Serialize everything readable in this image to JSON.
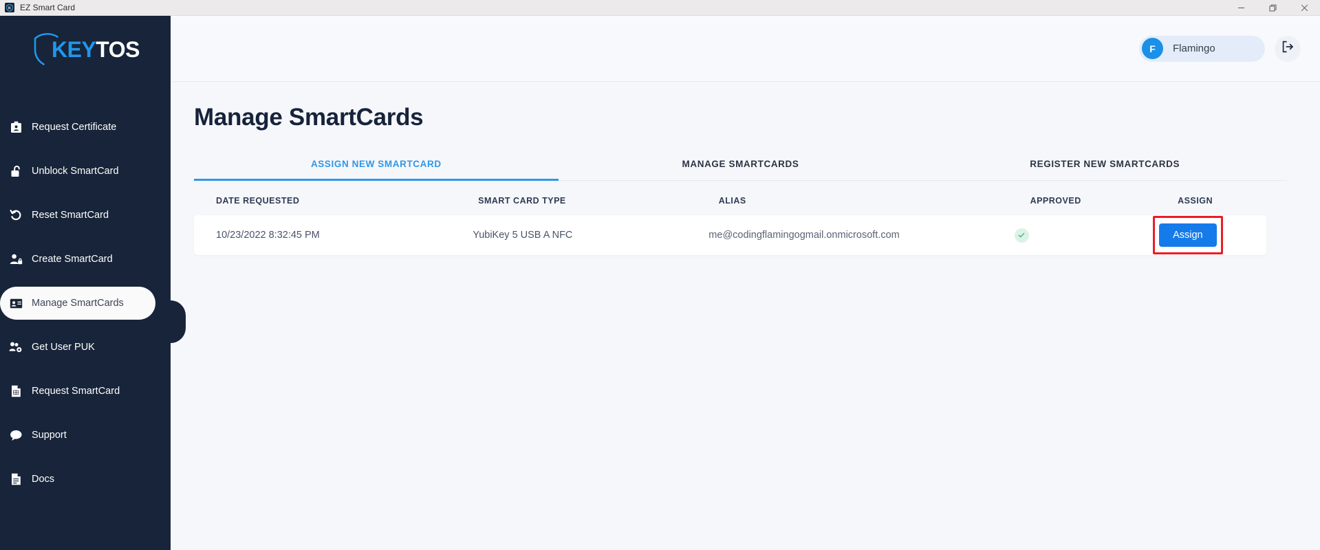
{
  "window": {
    "title": "EZ Smart Card",
    "app_icon": "shield-key-icon",
    "minimize_label": "minimize-icon",
    "restore_label": "restore-icon",
    "close_label": "close-icon"
  },
  "brand": {
    "logo_key": "KEY",
    "logo_tos": "TOS",
    "accent_color": "#2196ea",
    "sidebar_color": "#172439"
  },
  "sidebar": {
    "items": [
      {
        "label": "Request Certificate",
        "icon": "id-badge-icon",
        "active": false
      },
      {
        "label": "Unblock SmartCard",
        "icon": "padlock-open-icon",
        "active": false
      },
      {
        "label": "Reset SmartCard",
        "icon": "undo-arrow-icon",
        "active": false
      },
      {
        "label": "Create SmartCard",
        "icon": "user-lock-icon",
        "active": false
      },
      {
        "label": "Manage SmartCards",
        "icon": "id-card-icon",
        "active": true
      },
      {
        "label": "Get User PUK",
        "icon": "users-gear-icon",
        "active": false
      },
      {
        "label": "Request SmartCard",
        "icon": "document-grid-icon",
        "active": false
      },
      {
        "label": "Support",
        "icon": "chat-bubble-icon",
        "active": false
      },
      {
        "label": "Docs",
        "icon": "file-text-icon",
        "active": false
      }
    ]
  },
  "topbar": {
    "user_initial": "F",
    "user_name": "Flamingo",
    "logout_icon": "sign-out-icon"
  },
  "main": {
    "page_title": "Manage SmartCards",
    "tabs": [
      {
        "label": "ASSIGN NEW SMARTCARD",
        "active": true
      },
      {
        "label": "MANAGE SMARTCARDS",
        "active": false
      },
      {
        "label": "REGISTER NEW SMARTCARDS",
        "active": false
      }
    ],
    "table": {
      "columns": [
        "DATE REQUESTED",
        "SMART CARD TYPE",
        "ALIAS",
        "APPROVED",
        "ASSIGN"
      ],
      "rows": [
        {
          "date_requested": "10/23/2022 8:32:45 PM",
          "smart_card_type": "YubiKey 5 USB A NFC",
          "alias": "me@codingflamingogmail.onmicrosoft.com",
          "approved": "check-icon",
          "assign_label": "Assign"
        }
      ]
    },
    "annotation": {
      "target": "assign-button",
      "color": "#ee1b24"
    }
  }
}
